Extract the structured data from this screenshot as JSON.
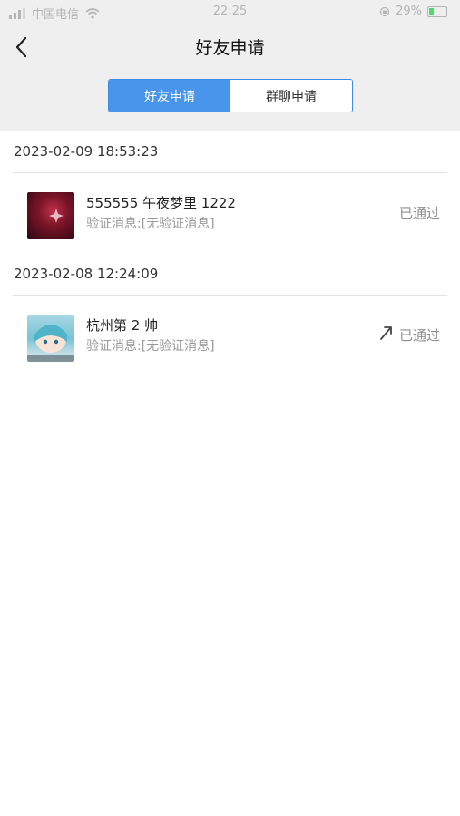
{
  "status_bar": {
    "carrier": "中国电信",
    "time": "22:25",
    "battery": "29%"
  },
  "header": {
    "title": "好友申请",
    "back_icon": "chevron-left-icon"
  },
  "tabs": [
    {
      "label": "好友申请",
      "active": true
    },
    {
      "label": "群聊申请",
      "active": false
    }
  ],
  "colors": {
    "accent": "#4a95ec",
    "background": "#efefef"
  },
  "groups": [
    {
      "date": "2023-02-09 18:53:23",
      "items": [
        {
          "name": "555555 午夜梦里 1222",
          "message": "验证消息:[无验证消息]",
          "status": "已通过"
        }
      ]
    },
    {
      "date": "2023-02-08 12:24:09",
      "items": [
        {
          "name": "杭州第 2 帅",
          "message": "验证消息:[无验证消息]",
          "status": "已通过"
        }
      ]
    }
  ]
}
